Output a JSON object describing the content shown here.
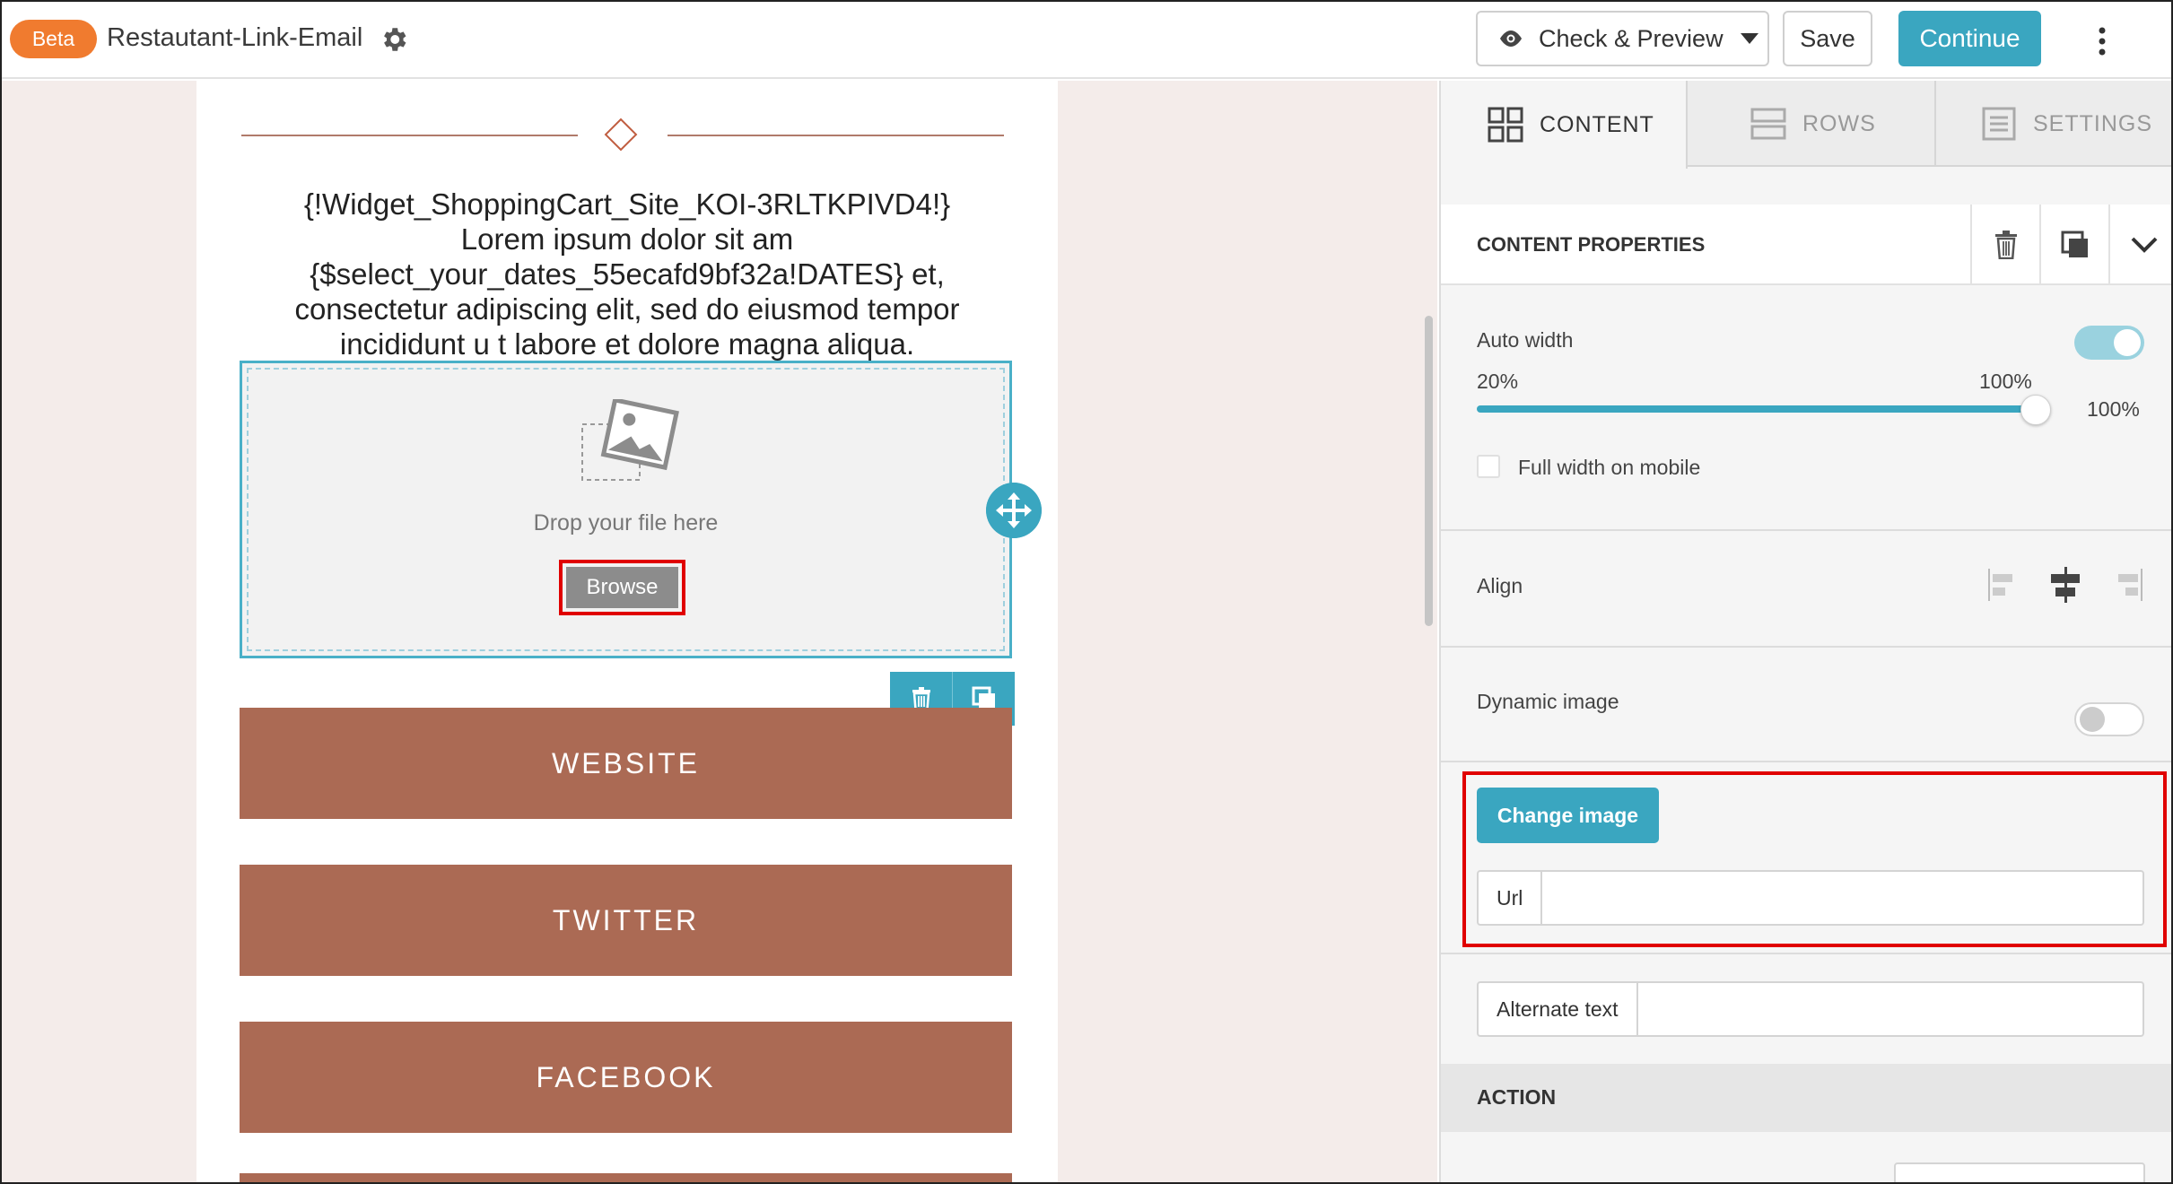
{
  "header": {
    "beta_badge": "Beta",
    "title": "Restautant-Link-Email",
    "preview_label": "Check & Preview",
    "save_label": "Save",
    "continue_label": "Continue",
    "accent_color": "#3aa6c0",
    "beta_color": "#f07b2f"
  },
  "email": {
    "body_lines": [
      "{!Widget_ShoppingCart_Site_KOI-3RLTKPIVD4!}",
      "Lorem ipsum dolor sit am",
      "{$select_your_dates_55ecafd9bf32a!DATES} et,",
      "consectetur adipiscing elit, sed do eiusmod tempor",
      "incididunt u t labore et dolore magna aliqua."
    ],
    "drop_text": "Drop your file here",
    "browse_label": "Browse",
    "buttons": [
      "WEBSITE",
      "TWITTER",
      "FACEBOOK"
    ],
    "button_color": "#ab6a54"
  },
  "panel": {
    "tabs": [
      {
        "label": "CONTENT",
        "active": true
      },
      {
        "label": "ROWS",
        "active": false
      },
      {
        "label": "SETTINGS",
        "active": false
      }
    ],
    "section_title": "CONTENT PROPERTIES",
    "auto_width_label": "Auto width",
    "auto_width_on": true,
    "slider_min": "20%",
    "slider_max": "100%",
    "slider_value": "100%",
    "full_width_mobile_label": "Full width on mobile",
    "align_label": "Align",
    "align_selected": "center",
    "dynamic_image_label": "Dynamic image",
    "dynamic_image_on": false,
    "change_image_label": "Change image",
    "url_label": "Url",
    "url_value": "",
    "alt_text_label": "Alternate text",
    "alt_text_value": "",
    "action_title": "ACTION"
  }
}
